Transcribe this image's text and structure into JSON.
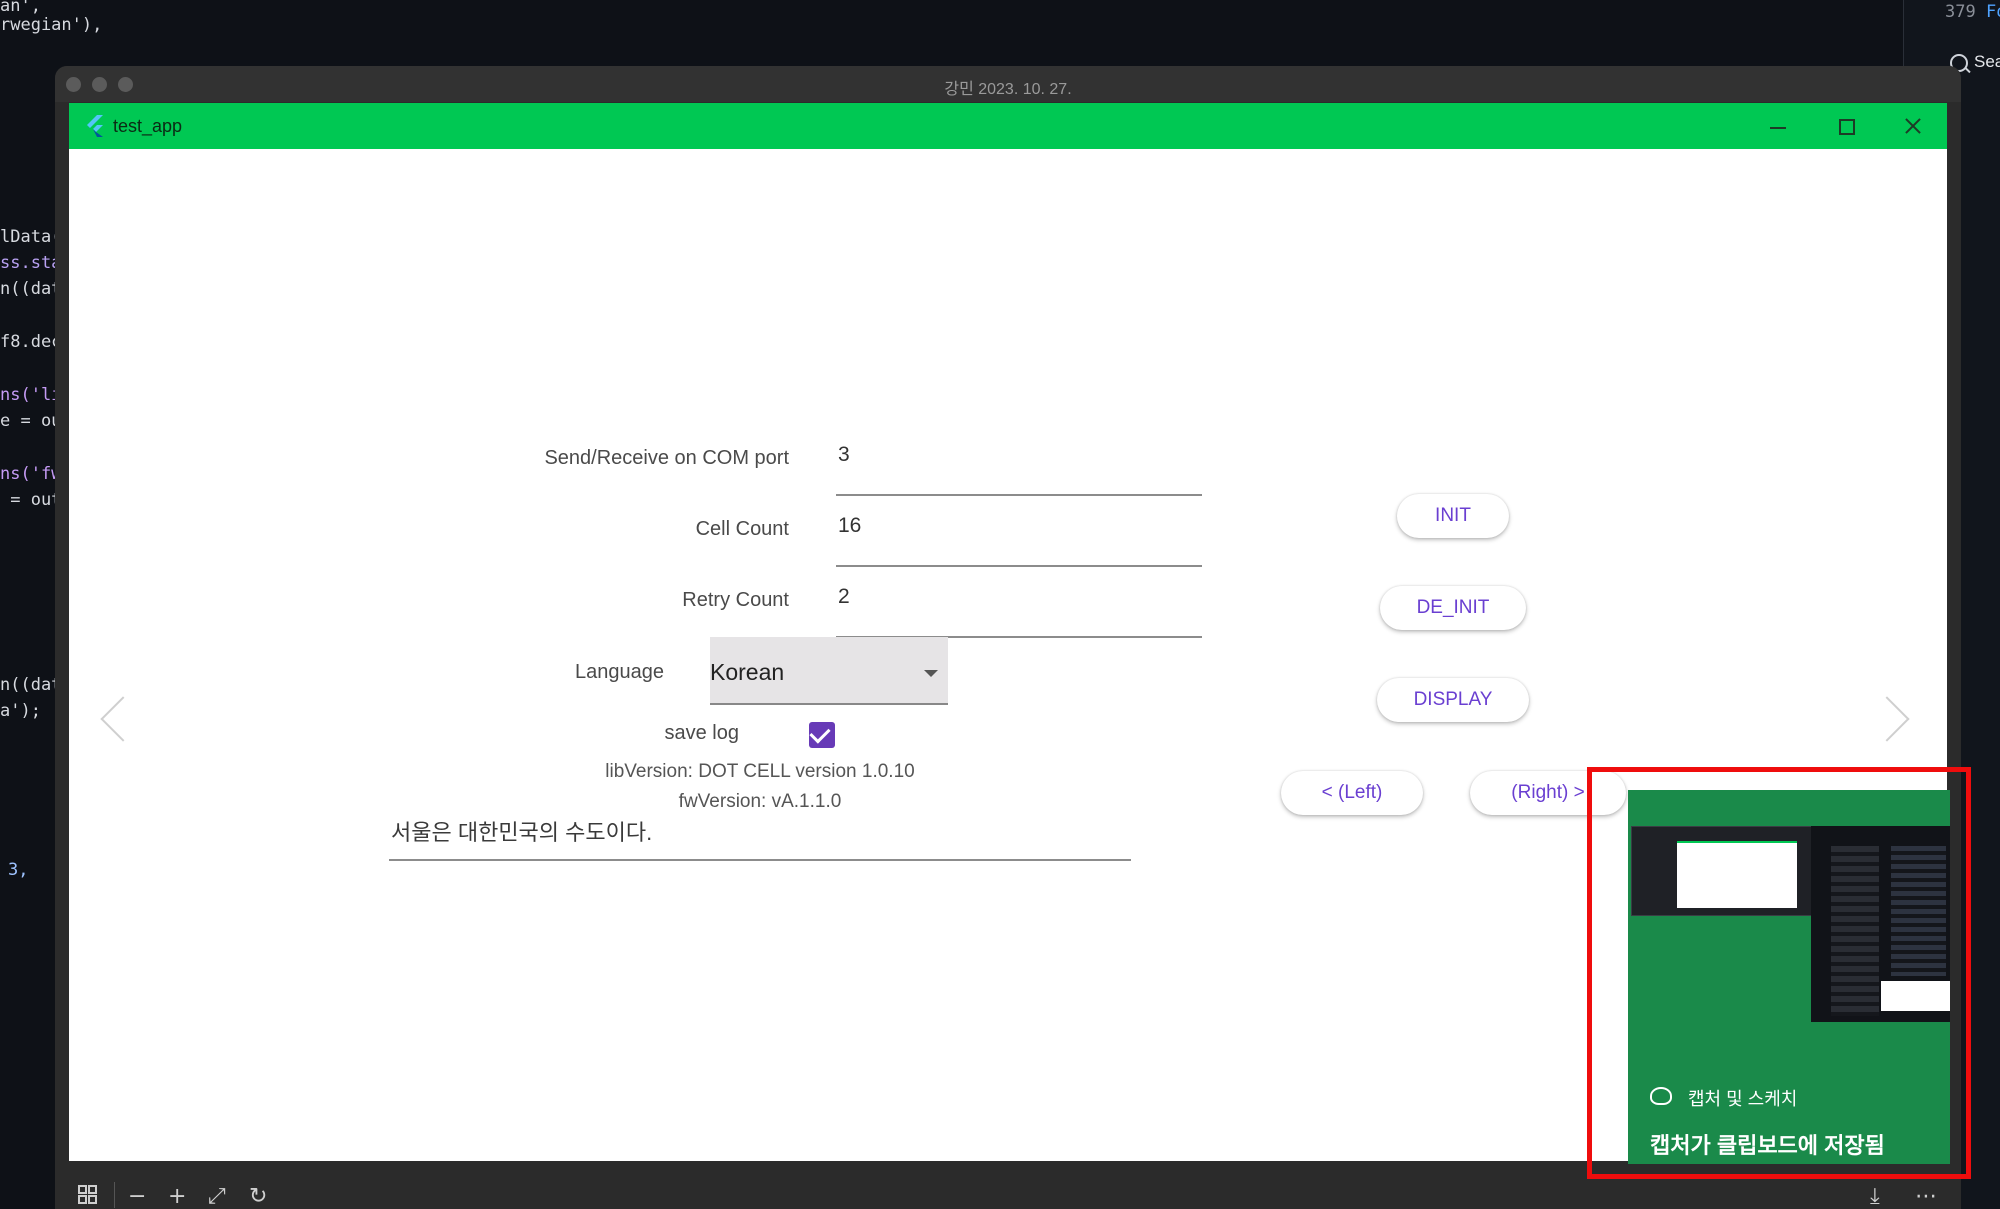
{
  "background_code": {
    "lines": [
      {
        "text": "an',"
      },
      {
        "text": "rwegian'),"
      },
      {
        "text": "lData("
      },
      {
        "text": "ss.sta"
      },
      {
        "text": "n((dat"
      },
      {
        "text": "f8.dec"
      },
      {
        "text": "ns('li"
      },
      {
        "text": "e = ou"
      },
      {
        "text": "ns('fw"
      },
      {
        "text": " = out"
      },
      {
        "text": "n((dat"
      },
      {
        "text": "a');"
      },
      {
        "text": "3,"
      }
    ],
    "line_number": "379",
    "fold_tag": "Fo",
    "search_label": "Sea"
  },
  "viewer": {
    "title": "강민 2023. 10. 27.",
    "toolbar_icons": [
      "grid-icon",
      "zoom-out-icon",
      "zoom-in-icon",
      "expand-icon",
      "rotate-icon",
      "download-icon",
      "more-icon"
    ]
  },
  "app": {
    "title": "test_app",
    "titlebar_color": "#00c853",
    "accent": "#673ab7",
    "form": {
      "com_port": {
        "label": "Send/Receive on COM port",
        "value": "3"
      },
      "cell_count": {
        "label": "Cell Count",
        "value": "16"
      },
      "retry_count": {
        "label": "Retry Count",
        "value": "2"
      },
      "language": {
        "label": "Language",
        "value": "Korean"
      },
      "save_log": {
        "label": "save log",
        "checked": true
      }
    },
    "lib_version": "libVersion: DOT CELL version 1.0.10",
    "fw_version": "fwVersion: vA.1.1.0",
    "text_input": "서울은 대한민국의 수도이다.",
    "buttons": {
      "init": "INIT",
      "de_init": "DE_INIT",
      "display": "DISPLAY",
      "left": "< (Left)",
      "right": "(Right) >"
    }
  },
  "toast": {
    "app_name": "캡처 및 스케치",
    "message": "캡처가 클립보드에 저장됨",
    "highlight_color": "#ef0d0d"
  }
}
